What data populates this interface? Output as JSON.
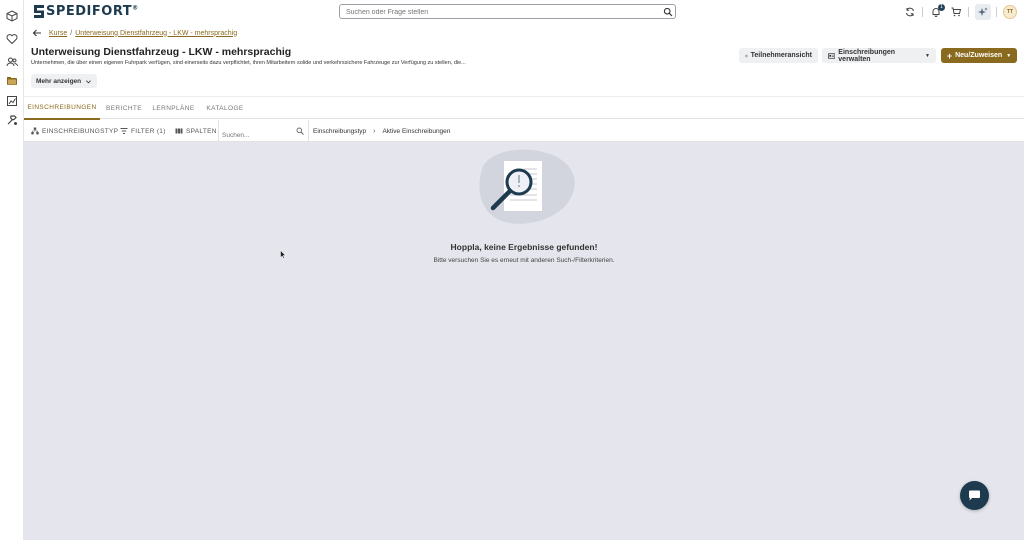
{
  "app": {
    "brand": "SPEDIFORT",
    "brand_reg": "®"
  },
  "topbar": {
    "search_placeholder": "Suchen oder Frage stellen",
    "notification_count": "1",
    "avatar_initials": "TT"
  },
  "breadcrumb": {
    "root": "Kurse",
    "separator": "/",
    "current": "Unterweisung Dienstfahrzeug - LKW - mehrsprachig"
  },
  "header": {
    "title": "Unterweisung Dienstfahrzeug - LKW - mehrsprachig",
    "description": "Unternehmen, die über einen eigenen Fuhrpark verfügen, sind einerseits dazu verpflichtet, ihren Mitarbeitern solide und verkehrssichere Fahrzeuge zur Verfügung zu stellen, die...",
    "more_label": "Mehr anzeigen",
    "participant_view_label": "Teilnehmeransicht",
    "manage_enrollments_label": "Einschreibungen verwalten",
    "new_assign_label": "Neu/Zuweisen"
  },
  "tabs": [
    {
      "label": "EINSCHREIBUNGEN",
      "active": true
    },
    {
      "label": "BERICHTE",
      "active": false
    },
    {
      "label": "LERNPLÄNE",
      "active": false
    },
    {
      "label": "KATALOGE",
      "active": false
    }
  ],
  "toolbar": {
    "enrollment_type_label": "EINSCHREIBUNGSTYP",
    "filter_label": "FILTER (1)",
    "columns_label": "SPALTEN",
    "search_placeholder": "Suchen...",
    "crumb_type": "Einschreibungstyp",
    "crumb_chevron": "›",
    "crumb_value": "Aktive Einschreibungen"
  },
  "empty_state": {
    "title": "Hoppla, keine Ergebnisse gefunden!",
    "subtitle": "Bitte versuchen Sie es erneut mit anderen Such-/Filterkriterien."
  },
  "colors": {
    "accent": "#8a6a1e",
    "brand_dark": "#1d3a4f",
    "content_bg": "#e4e5ed"
  },
  "icons": {
    "rail": [
      "cube-icon",
      "heart-icon",
      "users-icon",
      "folder-icon",
      "chart-icon",
      "tools-icon"
    ],
    "topbar": [
      "sync-icon",
      "bell-icon",
      "cart-icon",
      "sparkle-icon"
    ]
  }
}
